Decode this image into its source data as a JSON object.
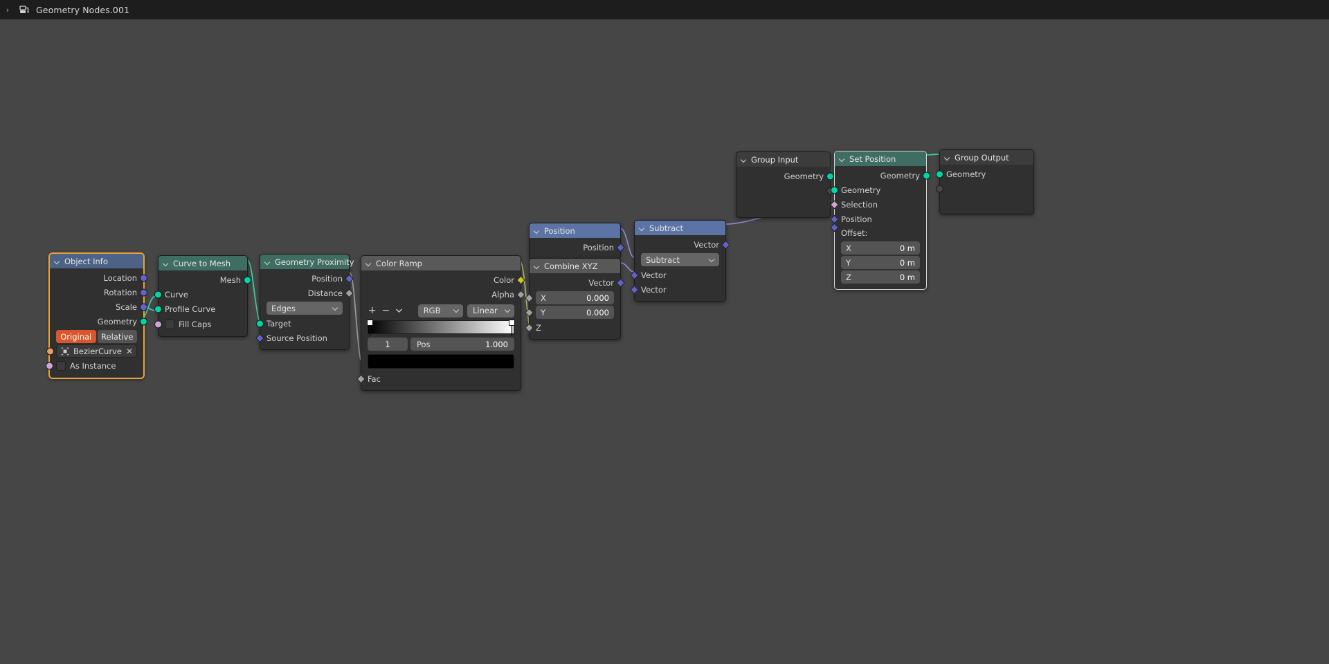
{
  "topbar": {
    "arrow_icon": "chevron-right-icon",
    "editor_icon": "geometry-nodes-editor-icon",
    "title": "Geometry Nodes.001"
  },
  "colors": {
    "canvas": "#464646",
    "node_body": "#303030",
    "header_geometry": "#3f6d62",
    "header_input": "#4c6387",
    "header_vector": "#5b74a5",
    "header_color": "#595959",
    "header_group": "#3c3c3c",
    "selected_outline": "#e9a33b",
    "active_outline": "#d6d6d6",
    "socket_geometry": "#00d6a3",
    "socket_vector": "#6363c7",
    "socket_value": "#a1a1a1",
    "socket_color": "#c7c729",
    "socket_object": "#ed9e5c",
    "socket_boolean": "#cca6d6",
    "toggle_active": "#d9552b",
    "wire": "#9b9b9b"
  },
  "nodes": {
    "object_info": {
      "title": "Object Info",
      "outputs": [
        "Location",
        "Rotation",
        "Scale",
        "Geometry"
      ],
      "space_original": "Original",
      "space_relative": "Relative",
      "object_name": "BezierCurve",
      "clear_icon": "close-x-icon",
      "object_icon": "object-data-icon",
      "as_instance_label": "As Instance",
      "as_instance_checked": false
    },
    "curve_to_mesh": {
      "title": "Curve to Mesh",
      "outputs": [
        "Mesh"
      ],
      "inputs": [
        "Curve",
        "Profile Curve"
      ],
      "fill_caps_label": "Fill Caps",
      "fill_caps_checked": false
    },
    "geometry_proximity": {
      "title": "Geometry Proximity",
      "outputs": [
        "Position",
        "Distance"
      ],
      "target_element": "Edges",
      "inputs": [
        "Target",
        "Source Position"
      ]
    },
    "color_ramp": {
      "title": "Color Ramp",
      "outputs": [
        "Color",
        "Alpha"
      ],
      "add_icon": "plus-icon",
      "remove_icon": "minus-icon",
      "menu_icon": "chevron-down-icon",
      "color_mode": "RGB",
      "interpolation": "Linear",
      "stop_index": "1",
      "pos_label": "Pos",
      "pos_value": "1.000",
      "stop_color": "#000000",
      "inputs": [
        "Fac"
      ]
    },
    "position": {
      "title": "Position",
      "outputs": [
        "Position"
      ]
    },
    "combine_xyz": {
      "title": "Combine XYZ",
      "outputs": [
        "Vector"
      ],
      "fields": [
        {
          "label": "X",
          "value": "0.000"
        },
        {
          "label": "Y",
          "value": "0.000"
        }
      ],
      "inputs": [
        "Z"
      ]
    },
    "subtract": {
      "title": "Subtract",
      "outputs": [
        "Vector"
      ],
      "operation": "Subtract",
      "inputs": [
        "Vector",
        "Vector"
      ]
    },
    "group_input": {
      "title": "Group Input",
      "outputs": [
        "Geometry"
      ]
    },
    "set_position": {
      "title": "Set Position",
      "outputs": [
        "Geometry"
      ],
      "inputs": [
        "Geometry",
        "Selection",
        "Position"
      ],
      "offset_label": "Offset:",
      "offset_fields": [
        {
          "label": "X",
          "value": "0 m"
        },
        {
          "label": "Y",
          "value": "0 m"
        },
        {
          "label": "Z",
          "value": "0 m"
        }
      ]
    },
    "group_output": {
      "title": "Group Output",
      "inputs": [
        "Geometry"
      ]
    }
  }
}
